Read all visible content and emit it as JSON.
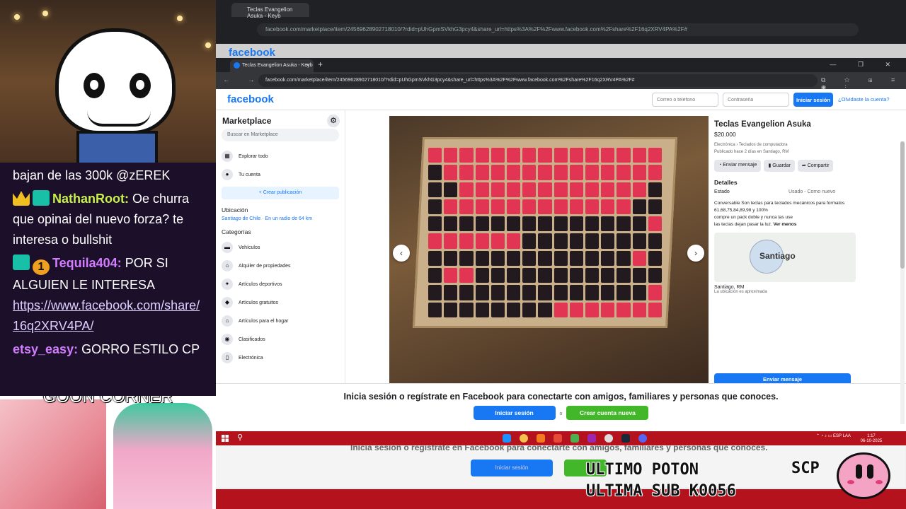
{
  "chat": {
    "line0": "bajan de las 300k @zEREK",
    "msg1_user": "NathanRoot:",
    "msg1_text": " Oe churra que opinai del nuevo forza? te interesa o bullshit",
    "msg2_user": "Tequila404:",
    "msg2_text": " POR SI ALGUIEN LE INTERESA",
    "msg2_link": "https://www.facebook.com/share/16q2XRV4PA/",
    "msg3_user": "etsy_easy:",
    "msg3_text": " GORRO ESTILO CP",
    "badge_one": "1"
  },
  "goon_title": "GOON CORNER",
  "back_window": {
    "tab_title": "Teclas Evangelion Asuka - Keyb",
    "url": "facebook.com/marketplace/item/24569628902718010/?rdid=pUhGpmSVkhG3pcy4&share_url=https%3A%2F%2Fwww.facebook.com%2Fshare%2F16q2XRV4PA%2F#",
    "logo": "facebook"
  },
  "browser": {
    "tab_title": "Teclas Evangelion Asuka - Keyb",
    "new_tab": "+",
    "tab_close": "✕",
    "win_controls": "— ❐ ✕",
    "nav": "← → ↻ ⚲",
    "url": "facebook.com/marketplace/item/24569628902718010/?rdid=pUhGpmSVkhG3pcy4&share_url=https%3A%2F%2Fwww.facebook.com%2Fshare%2F16q2XRV4PA%2F#",
    "toolbar_icons": "⧉ ☆ ⊞ ≡ ◉ ⋮"
  },
  "fb_header": {
    "logo": "facebook",
    "email_placeholder": "Correo o teléfono",
    "password_placeholder": "Contraseña",
    "login": "Iniciar sesión",
    "forgot": "¿Olvidaste la cuenta?"
  },
  "sidebar": {
    "title": "Marketplace",
    "search_placeholder": "Buscar en Marketplace",
    "explore": "Explorar todo",
    "account": "Tu cuenta",
    "create": "+ Crear publicación",
    "location_title": "Ubicación",
    "location_value": "Santiago de Chile · En un radio de 64 km",
    "categories_title": "Categorías",
    "categories": [
      "Vehículos",
      "Alquiler de propiedades",
      "Artículos deportivos",
      "Artículos gratuitos",
      "Artículos para el hogar",
      "Clasificados",
      "Electrónica"
    ]
  },
  "listing": {
    "title": "Teclas Evangelion Asuka",
    "price": "$20.000",
    "breadcrumb": "Electrónica › Teclados de computadora",
    "posted": "Publicado hace 2 días en Santiago, RM",
    "send_msg": "Enviar mensaje",
    "save": "Guardar",
    "share": "Compartir",
    "details_title": "Detalles",
    "condition_label": "Estado",
    "condition_value": "Usado - Como nuevo",
    "description_1": "Conversable Son teclas para teclados mecánicos  para formatos",
    "description_2": "61,68,75,84,89,98 y 100%",
    "description_3": "compre un pack doble y nunca las use",
    "description_4": "las teclas dejan pasar la luz.",
    "see_less": "Ver menos",
    "map_city": "Santiago",
    "location": "Santiago, RM",
    "location_note": "La ubicación es aproximada",
    "send_btn": "Enviar mensaje"
  },
  "banner": {
    "text": "Inicia sesión o regístrate en Facebook para conectarte con amigos, familiares y personas que conoces.",
    "login": "Iniciar sesión",
    "or": "o",
    "signup": "Crear cuenta nueva"
  },
  "taskbar": {
    "search_icon": "⚲",
    "lang": "ESP LAA",
    "time": "1:17",
    "date": "06-10-2025"
  },
  "mirror": {
    "text": "Inicia sesión o regístrate en Facebook para conectarte con amigos, familiares y personas que conoces.",
    "login": "Iniciar sesión"
  },
  "overlay": {
    "line1": "ULTIMO POTON",
    "line2": "ULTIMA SUB K0056",
    "scp": "SCP"
  }
}
